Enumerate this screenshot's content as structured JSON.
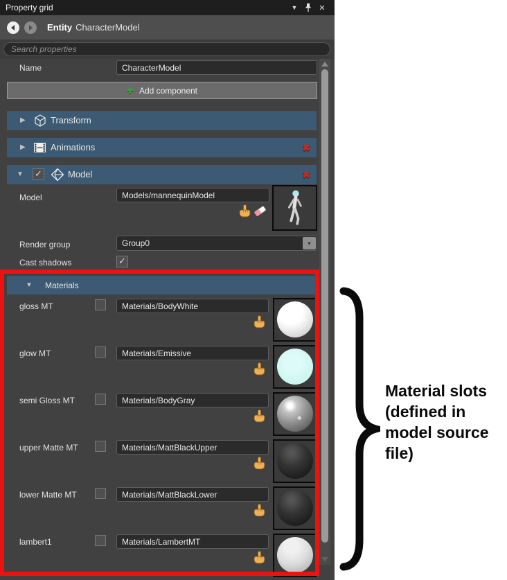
{
  "window": {
    "title": "Property grid"
  },
  "icons": {
    "collapse_panel": "▼",
    "close": "✕",
    "expander_collapsed": "▶",
    "expander_expanded": "▼",
    "delete": "✖",
    "add_plus": "+",
    "combo_chevron": "▼",
    "check": "✓"
  },
  "breadcrumb": {
    "type_label": "Entity",
    "name": "CharacterModel"
  },
  "search": {
    "placeholder": "Search properties"
  },
  "name_row": {
    "label": "Name",
    "value": "CharacterModel"
  },
  "add_component": {
    "label": "Add component"
  },
  "sections": {
    "transform": {
      "label": "Transform"
    },
    "animations": {
      "label": "Animations"
    },
    "model": {
      "label": "Model"
    }
  },
  "model": {
    "model_row": {
      "label": "Model",
      "value": "Models/mannequinModel"
    },
    "render_group": {
      "label": "Render group",
      "value": "Group0"
    },
    "cast_shadows": {
      "label": "Cast shadows",
      "checked": true
    },
    "materials": {
      "label": "Materials",
      "rows": [
        {
          "label": "gloss MT",
          "value": "Materials/BodyWhite",
          "thumb": "white-gloss"
        },
        {
          "label": "glow MT",
          "value": "Materials/Emissive",
          "thumb": "cyan-emissive"
        },
        {
          "label": "semi Gloss MT",
          "value": "Materials/BodyGray",
          "thumb": "gray-gloss"
        },
        {
          "label": "upper Matte MT",
          "value": "Materials/MattBlackUpper",
          "thumb": "black-matte"
        },
        {
          "label": "lower Matte MT",
          "value": "Materials/MattBlackLower",
          "thumb": "black-matte"
        },
        {
          "label": "lambert1",
          "value": "Materials/LambertMT",
          "thumb": "light-matte"
        }
      ]
    }
  },
  "annotation": {
    "lines": [
      "Material slots",
      "(defined in",
      "model source",
      "file)"
    ],
    "highlight_color": "#ee1111",
    "brace_color": "#000000"
  },
  "colors": {
    "section_header_bg": "#3c5a73",
    "panel_bg": "#414141",
    "titlebar_bg": "#1e1e1e",
    "input_bg": "#2b2b2b",
    "accent_green": "#2fae35",
    "delete_red": "#c32b20"
  }
}
